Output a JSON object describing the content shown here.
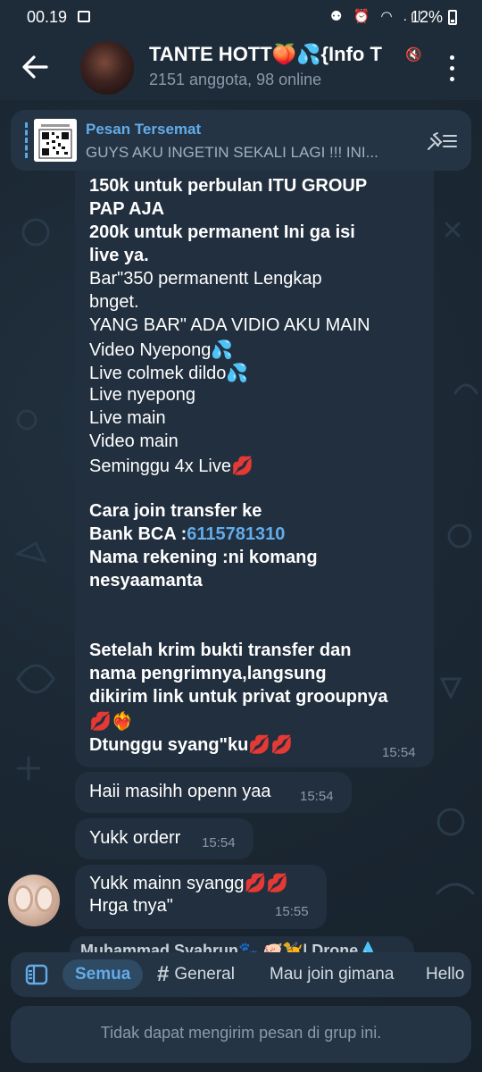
{
  "status_bar": {
    "time": "00.19",
    "icons": "⚉ ⏰ ◠ .ıl",
    "battery": "12%"
  },
  "header": {
    "title": "TANTE HOTT🍑💦{Info T",
    "subtitle": "2151 anggota, 98 online",
    "mute_glyph": "🔇"
  },
  "pinned": {
    "label": "Pesan Tersemat",
    "text": "GUYS AKU INGETIN SEKALI LAGI !!! INI..."
  },
  "main_message": {
    "time": "15:54",
    "lines": [
      {
        "pre": "150k untuk perbulan ITU GROUP",
        "link": ""
      },
      {
        "pre": "PAP AJA",
        "link": ""
      },
      {
        "pre": "200k untuk permanent Ini ga isi",
        "link": ""
      },
      {
        "pre": "live ya.",
        "link": ""
      },
      {
        "pre": "Bar\"350 permanentt Lengkap",
        "link": ""
      },
      {
        "pre": "bnget.",
        "link": ""
      },
      {
        "pre": "YANG BAR\" ADA VIDIO AKU MAIN",
        "link": ""
      },
      {
        "pre": "Video Nyepong💦",
        "link": ""
      },
      {
        "pre": "Live colmek dildo💦",
        "link": ""
      },
      {
        "pre": "Live nyepong",
        "link": ""
      },
      {
        "pre": "Live main",
        "link": ""
      },
      {
        "pre": "Video main",
        "link": ""
      },
      {
        "pre": "Seminggu 4x Live💋",
        "link": ""
      },
      {
        "pre": "Cara join transfer ke",
        "link": ""
      },
      {
        "pre": "Bank BCA :",
        "link": "6115781310"
      },
      {
        "pre": "Nama rekening :ni komang",
        "link": ""
      },
      {
        "pre": "nesyaamanta",
        "link": ""
      },
      {
        "pre": "Setelah krim bukti transfer dan",
        "link": ""
      },
      {
        "pre": "nama pengrimnya,langsung",
        "link": ""
      },
      {
        "pre": "dikirim link untuk privat grooupnya",
        "link": ""
      },
      {
        "pre": "💋❤️‍🔥",
        "link": ""
      },
      {
        "pre": "Dtunggu syang\"ku💋💋",
        "link": ""
      }
    ]
  },
  "messages": [
    {
      "text": "Haii masihh openn yaa",
      "time": "15:54"
    },
    {
      "text": "Yukk orderr",
      "time": "15:54"
    },
    {
      "text": "Yukk mainn syangg💋💋",
      "text2": "Hrga tnya\"",
      "time": "15:55"
    }
  ],
  "peek_message": "Muhammad Syahrun🐾 🐖🦮| Drone💧",
  "tabs": {
    "items": [
      "Semua",
      "General",
      "Mau join gimana",
      "Hello"
    ]
  },
  "input": {
    "placeholder": "Tidak dapat mengirim pesan di grup ini."
  }
}
